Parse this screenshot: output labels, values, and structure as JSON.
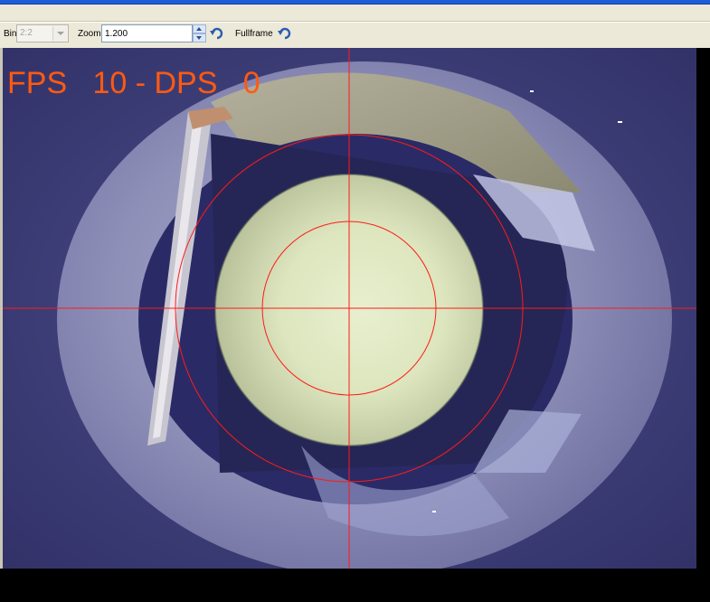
{
  "toolbar": {
    "bin_label": "Bin",
    "bin_value": "2:2",
    "zoom_label": "Zoom",
    "zoom_value": "1.200",
    "fullframe_label": "Fullframe"
  },
  "overlay": {
    "fps_text": "FPS   10 - DPS   0",
    "crosshair_color": "#ff1a1a"
  },
  "icons": {
    "zoom_reset": "undo-arrow-icon",
    "fullframe_reset": "undo-arrow-icon"
  }
}
